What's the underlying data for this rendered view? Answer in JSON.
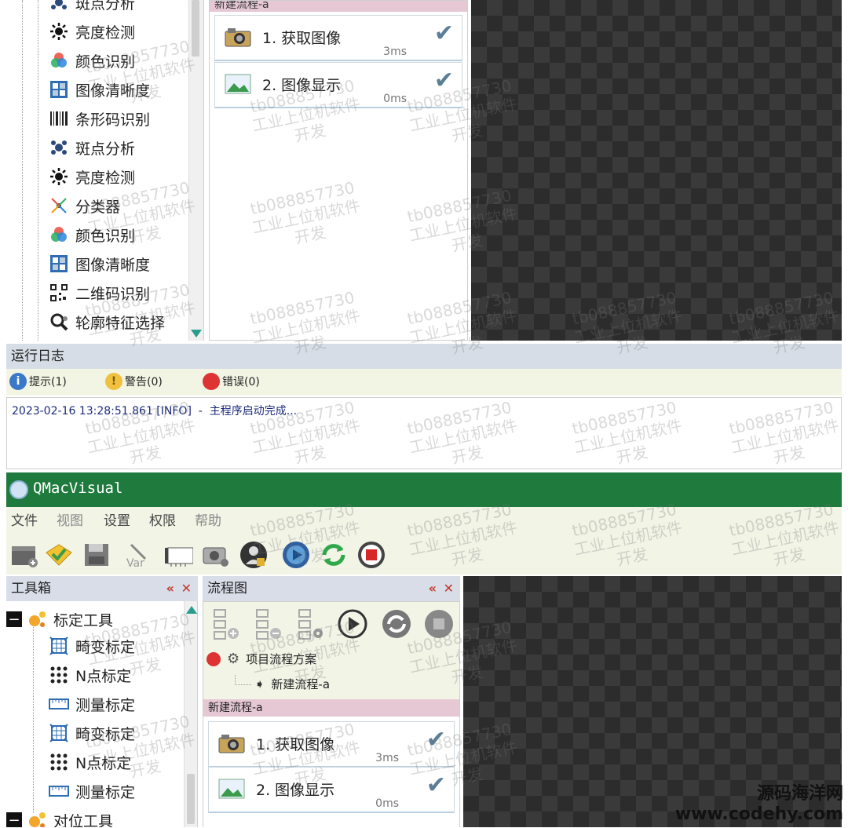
{
  "top_tree": {
    "items": [
      {
        "label": "斑点分析",
        "icon": "blob-icon"
      },
      {
        "label": "亮度检测",
        "icon": "brightness-icon"
      },
      {
        "label": "颜色识别",
        "icon": "color-icon"
      },
      {
        "label": "图像清晰度",
        "icon": "sharpness-icon"
      },
      {
        "label": "条形码识别",
        "icon": "barcode-icon"
      },
      {
        "label": "斑点分析",
        "icon": "blob-icon"
      },
      {
        "label": "亮度检测",
        "icon": "brightness-icon"
      },
      {
        "label": "分类器",
        "icon": "classifier-icon"
      },
      {
        "label": "颜色识别",
        "icon": "color-icon"
      },
      {
        "label": "图像清晰度",
        "icon": "sharpness-icon"
      },
      {
        "label": "二维码识别",
        "icon": "qrcode-icon"
      },
      {
        "label": "轮廓特征选择",
        "icon": "contour-icon"
      }
    ]
  },
  "top_flow": {
    "header": "新建流程-a",
    "steps": [
      {
        "label": "1. 获取图像",
        "time": "3ms"
      },
      {
        "label": "2. 图像显示",
        "time": "0ms"
      }
    ]
  },
  "log": {
    "title": "运行日志",
    "tabs": [
      {
        "symbol": "i",
        "label": "提示(1)",
        "color": "#3b78c9"
      },
      {
        "symbol": "!",
        "label": "警告(0)",
        "color": "#f0c040"
      },
      {
        "symbol": "",
        "label": "错误(0)",
        "color": "#d33"
      }
    ],
    "entry": "2023-02-16 13:28:51.861 [INFO]  -  主程序启动完成..."
  },
  "app": {
    "title": "QMacVisual",
    "menu": [
      "文件",
      "视图",
      "设置",
      "权限",
      "帮助"
    ]
  },
  "toolbox": {
    "title": "工具箱",
    "groups": [
      {
        "label": "标定工具",
        "items": [
          "畸变标定",
          "N点标定",
          "测量标定",
          "畸变标定",
          "N点标定",
          "测量标定"
        ]
      },
      {
        "label": "对位工具"
      }
    ]
  },
  "flowchart": {
    "title": "流程图",
    "root": "项目流程方案",
    "child": "新建流程-a",
    "header": "新建流程-a",
    "steps": [
      {
        "label": "1. 获取图像",
        "time": "3ms"
      },
      {
        "label": "2. 图像显示",
        "time": "0ms"
      }
    ]
  },
  "watermark": {
    "line1": "tb088857730",
    "line2": "工业上位机软件",
    "line3": "开发"
  },
  "brand": {
    "line1": "源码海洋网",
    "line2": "www.codehy.com"
  }
}
